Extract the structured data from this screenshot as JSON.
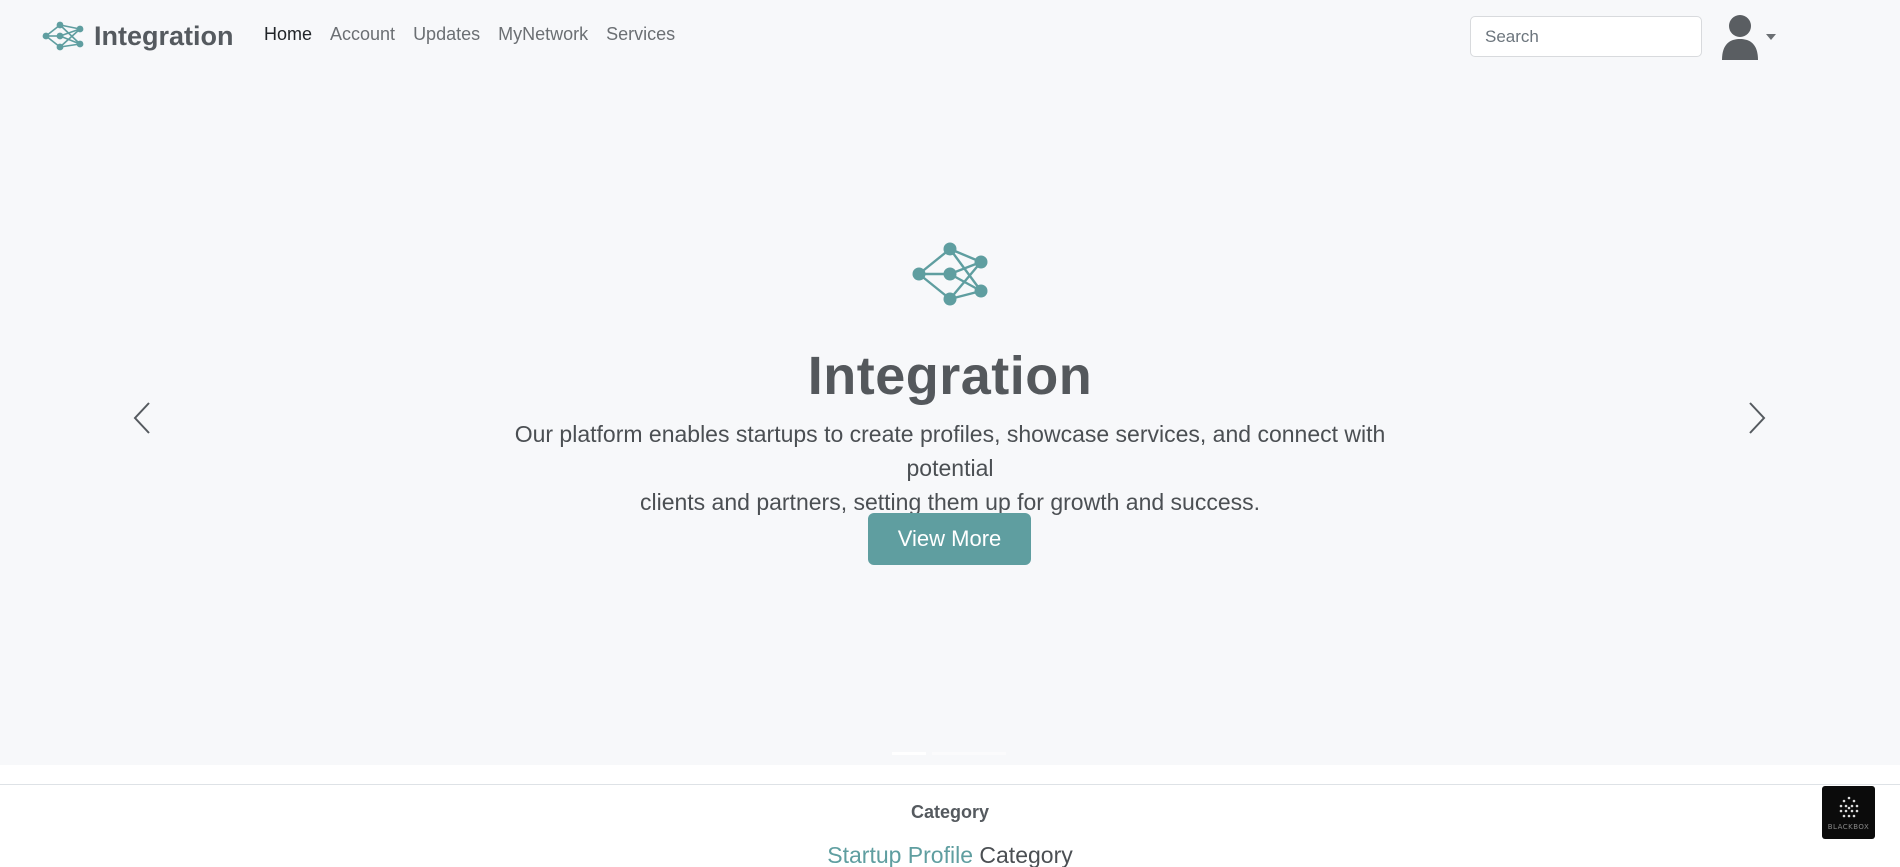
{
  "colors": {
    "accent": "#5f9ea0",
    "hero_bg": "#f7f8fa",
    "text": "#555a5f"
  },
  "navbar": {
    "brand": "Integration",
    "brand_icon": "network-logo-icon",
    "links": [
      {
        "label": "Home",
        "active": true
      },
      {
        "label": "Account",
        "active": false
      },
      {
        "label": "Updates",
        "active": false
      },
      {
        "label": "MyNetwork",
        "active": false
      },
      {
        "label": "Services",
        "active": false
      }
    ],
    "search": {
      "placeholder": "Search",
      "value": ""
    },
    "user_icon": "user-avatar-icon"
  },
  "hero": {
    "logo_icon": "network-logo-icon",
    "title": "Integration",
    "text_line1": "Our platform enables startups to create profiles, showcase services, and connect with potential",
    "text_line2": "clients and partners, setting them up for growth and success.",
    "button_label": "View More",
    "prev_icon": "chevron-left-icon",
    "next_icon": "chevron-right-icon",
    "slides": 2,
    "active_slide": 1
  },
  "category": {
    "label": "Category",
    "heading_accent": "Startup Profile",
    "heading_rest": "Category"
  },
  "widget": {
    "label": "BLACKBOX"
  }
}
